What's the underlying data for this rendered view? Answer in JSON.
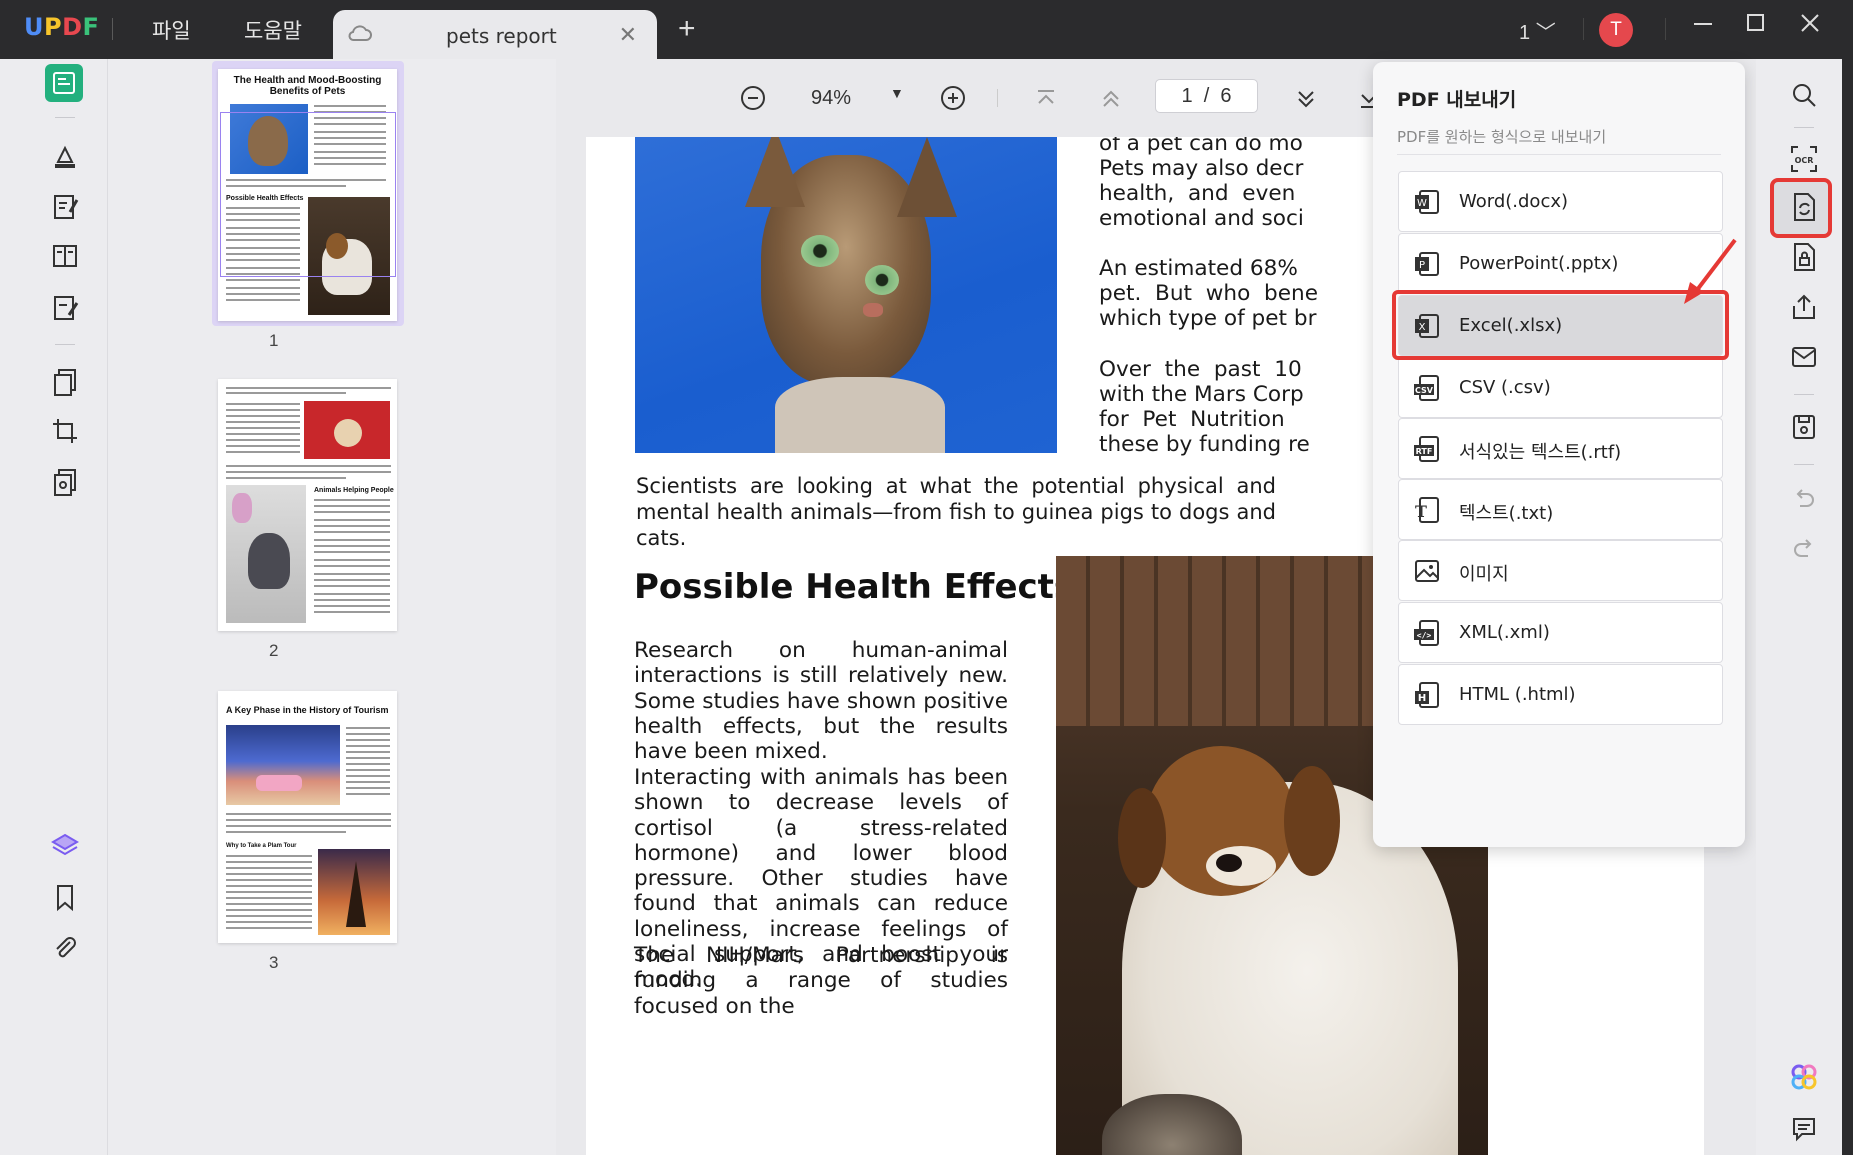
{
  "app": {
    "logo": "UPDF",
    "logo_colors": [
      "#4f8df7",
      "#f7c52b",
      "#e8484f",
      "#3ac27a"
    ],
    "menu": [
      "파일",
      "도움말"
    ],
    "tab_title": "pets report",
    "tab_close": "✕",
    "new_tab": "+",
    "page_indicator": "1",
    "avatar_letter": "T"
  },
  "toolbar": {
    "zoom": "94%",
    "page_current": "1",
    "page_sep": "/",
    "page_total": "6"
  },
  "thumbnails": {
    "pages": [
      {
        "number": "1",
        "title": "The Health and Mood-Boosting Benefits of Pets",
        "subheading": "Possible Health Effects"
      },
      {
        "number": "2",
        "subheading": "Animals Helping People"
      },
      {
        "number": "3",
        "title": "A Key Phase in the History of Tourism",
        "subheading": "Why to Take a Plam Tour"
      }
    ]
  },
  "document": {
    "right_col_lines": [
      "of a pet can do mo",
      "Pets may also decr",
      "health,  and  even",
      "emotional and soci",
      "",
      "An estimated 68%",
      "pet.  But  who  bene",
      "which type of pet br",
      "",
      "Over  the  past  10",
      "with the Mars Corp",
      "for  Pet  Nutrition",
      "these by funding re"
    ],
    "caption": "Scientists are looking at what the potential physical and mental health animals—from fish to guinea pigs to dogs and cats.",
    "heading": "Possible Health Effects",
    "para1": "Research on human-animal interactions is still relatively new. Some studies have shown positive health effects, but the results have been mixed.",
    "para2": "Interacting with animals has been shown to decrease levels of cortisol (a stress-related hormone) and lower blood pressure. Other studies have found that animals can reduce loneliness, increase feelings of social support, and boost your mood.",
    "para3": "The NIH/Mars Partnership is funding a range of studies focused on the"
  },
  "export_panel": {
    "title": "PDF 내보내기",
    "subtitle": "PDF를 원하는 형식으로 내보내기",
    "options": [
      {
        "label": "Word(.docx)",
        "icon": "word-icon",
        "color": "#2b579a",
        "letter": "W"
      },
      {
        "label": "PowerPoint(.pptx)",
        "icon": "powerpoint-icon",
        "color": "#c43e1c",
        "letter": "P"
      },
      {
        "label": "Excel(.xlsx)",
        "icon": "excel-icon",
        "color": "#217346",
        "letter": "X"
      },
      {
        "label": "CSV (.csv)",
        "icon": "csv-icon",
        "color": "#333",
        "letter": "CSV"
      },
      {
        "label": "서식있는 텍스트(.rtf)",
        "icon": "rtf-icon",
        "color": "#333",
        "letter": "RTF"
      },
      {
        "label": "텍스트(.txt)",
        "icon": "txt-icon",
        "color": "#333",
        "letter": "T"
      },
      {
        "label": "이미지",
        "icon": "image-icon",
        "color": "#333",
        "letter": ""
      },
      {
        "label": "XML(.xml)",
        "icon": "xml-icon",
        "color": "#333",
        "letter": "</>"
      },
      {
        "label": "HTML (.html)",
        "icon": "html-icon",
        "color": "#333",
        "letter": "H"
      }
    ],
    "selected": "Excel(.xlsx)",
    "highlight_color": "#e53935"
  }
}
